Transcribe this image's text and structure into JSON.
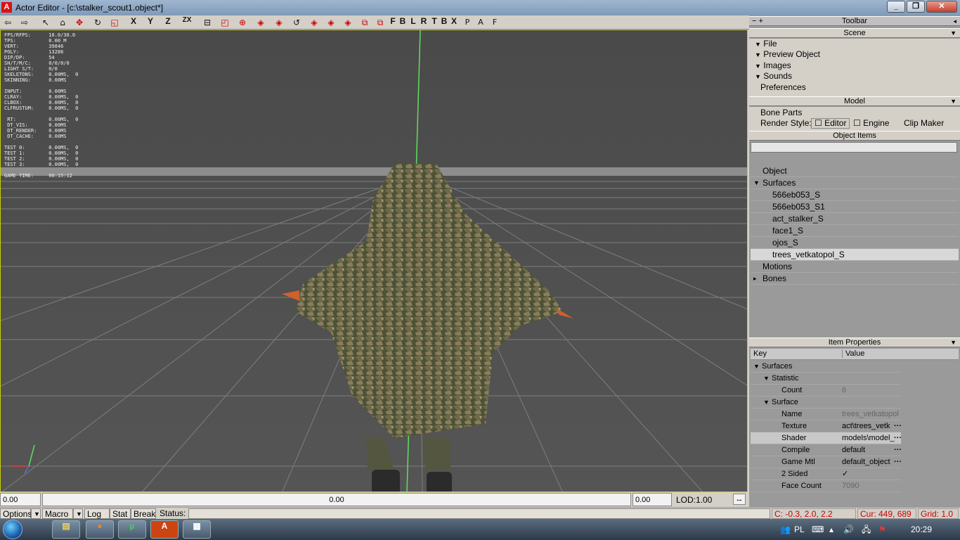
{
  "window": {
    "app_icon": "A",
    "title": "Actor Editor - [c:\\stalker_scout1.object*]",
    "min": "_",
    "max": "❐",
    "close": "✕"
  },
  "toolbar": {
    "letters": {
      "x": "X",
      "y": "Y",
      "z": "Z",
      "zx": "ZX",
      "f": "F",
      "b": "B",
      "l": "L",
      "r": "R",
      "t": "T",
      "b2": "B",
      "x2": "X",
      "p": "P",
      "a": "A",
      "f2": "F"
    }
  },
  "stats": [
    "FPS/RFPS:      10.0/30.0",
    "TPS:           0.00 M",
    "VERT:          39846",
    "POLY:          13286",
    "DIP/DP:        54",
    "SH/T/M/C:      0/0/0/0",
    "LIGHT S/T:     0/0",
    "SKELETONS:     0.00MS,  0",
    "SKINNING:      0.00MS",
    "",
    "INPUT:         0.00MS",
    "CLRAY:         0.00MS,  0",
    "CLBOX:         0.00MS,  0",
    "CLFRUSTUM:     0.00MS,  0",
    "",
    " RT:           0.00MS,  0",
    " DT_VIS:       0.00MS",
    " DT_RENDER:    0.00MS",
    " DT_CACHE:     0.00MS",
    "",
    "TEST 0:        0.00MS,  0",
    "TEST 1:        0.00MS,  0",
    "TEST 2:        0.00MS,  0",
    "TEST 3:        0.00MS,  0",
    "",
    "GAME TIME:     00:15:12"
  ],
  "bottom": {
    "left_value": "0.00",
    "center_value": "0.00",
    "right_value": "0.00",
    "lod_label": "LOD:",
    "lod_value": "1.00"
  },
  "statusbar": {
    "options": "Options",
    "macro": "Macro",
    "log": "Log",
    "stat": "Stat",
    "break": "Break",
    "status": "Status:",
    "coords": "C: -0.3, 2.0, 2.2",
    "cursor": "Cur: 449, 689",
    "grid": "Grid: 1.0"
  },
  "panel": {
    "header_minus": "− +",
    "toolbar_title": "Toolbar",
    "scene_title": "Scene",
    "scene_items": [
      "File",
      "Preview Object",
      "Images",
      "Sounds",
      "Preferences"
    ],
    "model_title": "Model",
    "bone_parts": "Bone Parts",
    "render_style": "Render Style:",
    "editor": "Editor",
    "engine": "Engine",
    "clip_maker": "Clip Maker",
    "object_items_title": "Object Items",
    "tree": [
      "Object",
      "Surfaces",
      "566eb053_S",
      "566eb053_S1",
      "act_stalker_S",
      "face1_S",
      "ojos_S",
      "trees_vetkatopol_S",
      "Motions",
      "Bones"
    ],
    "item_props_title": "Item Properties",
    "key_header": "Key",
    "value_header": "Value",
    "props": [
      {
        "key": "Surfaces",
        "value": ""
      },
      {
        "key": "Statistic",
        "value": ""
      },
      {
        "key": "Count",
        "value": "6"
      },
      {
        "key": "Surface",
        "value": ""
      },
      {
        "key": "Name",
        "value": "trees_vetkatopol"
      },
      {
        "key": "Texture",
        "value": "act\\trees_vetk"
      },
      {
        "key": "Shader",
        "value": "models\\model_"
      },
      {
        "key": "Compile",
        "value": "default"
      },
      {
        "key": "Game Mtl",
        "value": "default_object"
      },
      {
        "key": "2 Sided",
        "value": "✓"
      },
      {
        "key": "Face Count",
        "value": "7090"
      }
    ]
  },
  "taskbar": {
    "lang": "PL",
    "time": "20:29"
  }
}
